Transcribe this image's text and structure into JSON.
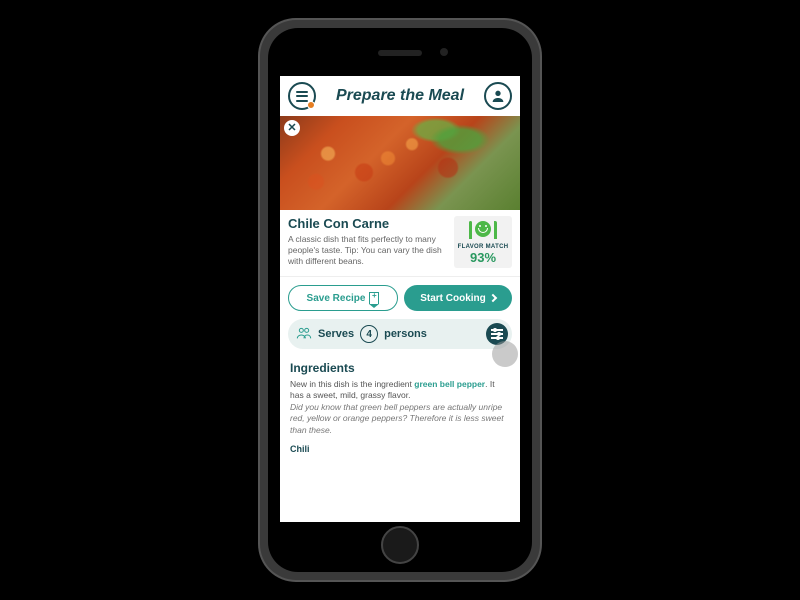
{
  "header": {
    "title": "Prepare the Meal"
  },
  "recipe": {
    "title": "Chile Con Carne",
    "description": "A classic dish that fits perfectly to many people's taste. Tip: You can vary the dish with different beans.",
    "flavor_match_label": "FLAVOR MATCH",
    "flavor_match_pct": "93%"
  },
  "actions": {
    "save_label": "Save Recipe",
    "start_label": "Start Cooking"
  },
  "serves": {
    "label_prefix": "Serves",
    "count": "4",
    "label_suffix": "persons"
  },
  "ingredients": {
    "heading": "Ingredients",
    "intro_a": "New in this dish is the ingredient ",
    "highlight": "green bell pepper",
    "intro_b": ". It has a sweet, mild, grassy flavor.",
    "tip": "Did you know that green bell peppers are actually unripe red, yellow or orange peppers? Therefore it is less sweet than these.",
    "first_item": "Chili"
  }
}
